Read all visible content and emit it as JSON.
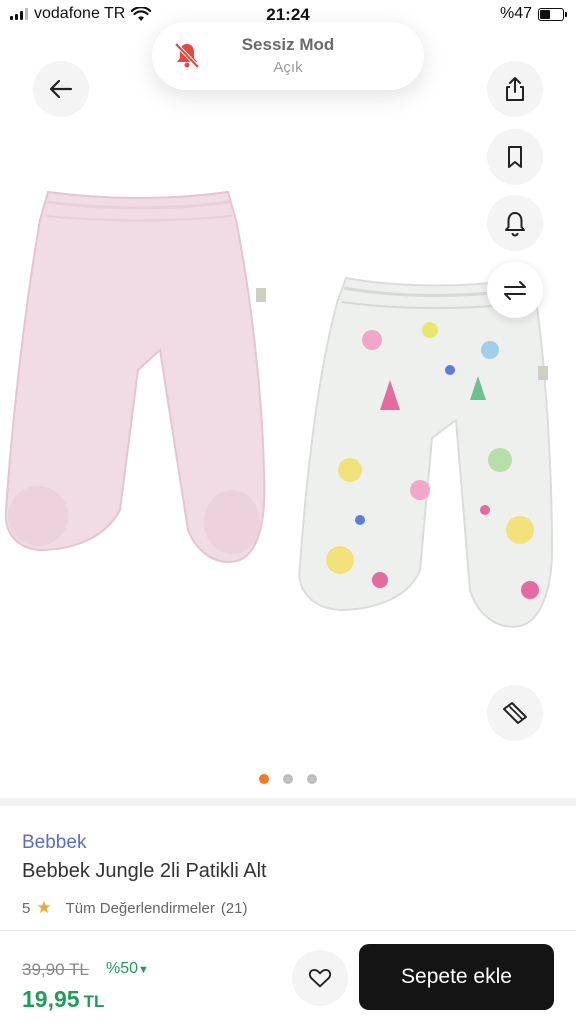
{
  "status_bar": {
    "carrier": "vodafone TR",
    "time": "21:24",
    "battery": "%47",
    "battery_level": 0.47
  },
  "toast": {
    "title": "Sessiz Mod",
    "subtitle": "Açık",
    "icon": "bell-slash-icon"
  },
  "actions": {
    "back_icon": "arrow-left-icon",
    "share_icon": "share-icon",
    "bookmark_icon": "bookmark-icon",
    "alert_icon": "bell-icon",
    "compare_icon": "compare-arrows-icon",
    "size_guide_icon": "ruler-icon"
  },
  "gallery": {
    "total": 3,
    "active_index": 0
  },
  "product": {
    "brand": "Bebbek",
    "name": "Bebbek Jungle 2li Patikli Alt",
    "rating": "5",
    "reviews_label": "Tüm Değerlendirmeler",
    "reviews_count": "(21)"
  },
  "pricing": {
    "old_price": "39,90 TL",
    "discount": "%50",
    "new_price": "19,95",
    "currency": "TL"
  },
  "cart": {
    "label": "Sepete ekle"
  },
  "colors": {
    "accent": "#f27a1a",
    "brand": "#5a6ad8",
    "price": "#1f9e5a",
    "cart_button": "#141414"
  }
}
